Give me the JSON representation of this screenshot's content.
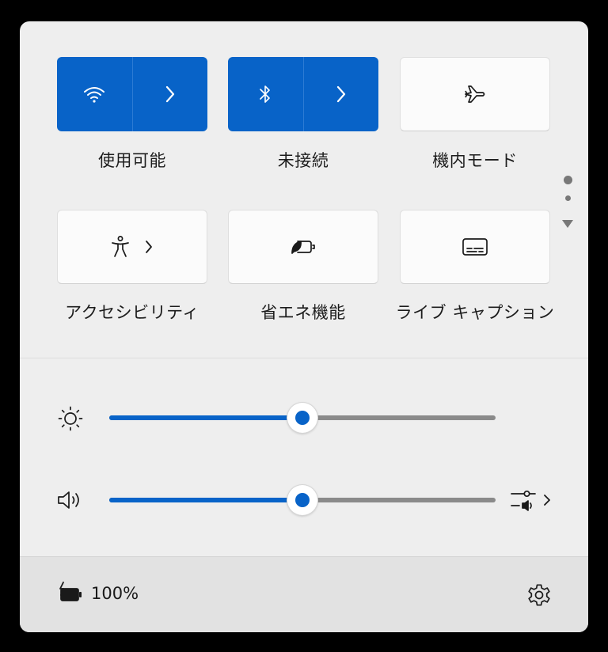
{
  "tiles": [
    {
      "label": "使用可能",
      "state": "on",
      "icon": "wifi-icon"
    },
    {
      "label": "未接続",
      "state": "on",
      "icon": "bluetooth-icon"
    },
    {
      "label": "機内モード",
      "state": "off",
      "icon": "airplane-icon"
    },
    {
      "label": "アクセシビリティ",
      "state": "off",
      "icon": "accessibility-icon"
    },
    {
      "label": "省エネ機能",
      "state": "off",
      "icon": "energy-saver-icon"
    },
    {
      "label": "ライブ キャプション",
      "state": "off",
      "icon": "captions-icon"
    }
  ],
  "brightness": {
    "percent": 50,
    "icon": "brightness-icon"
  },
  "volume": {
    "percent": 50,
    "icon": "speaker-icon"
  },
  "footer": {
    "battery_text": "100%",
    "battery_icon": "battery-charging-icon",
    "settings_icon": "gear-icon"
  },
  "colors": {
    "accent": "#0863c8",
    "panel": "#eeeeee",
    "footer": "#e2e2e2"
  }
}
